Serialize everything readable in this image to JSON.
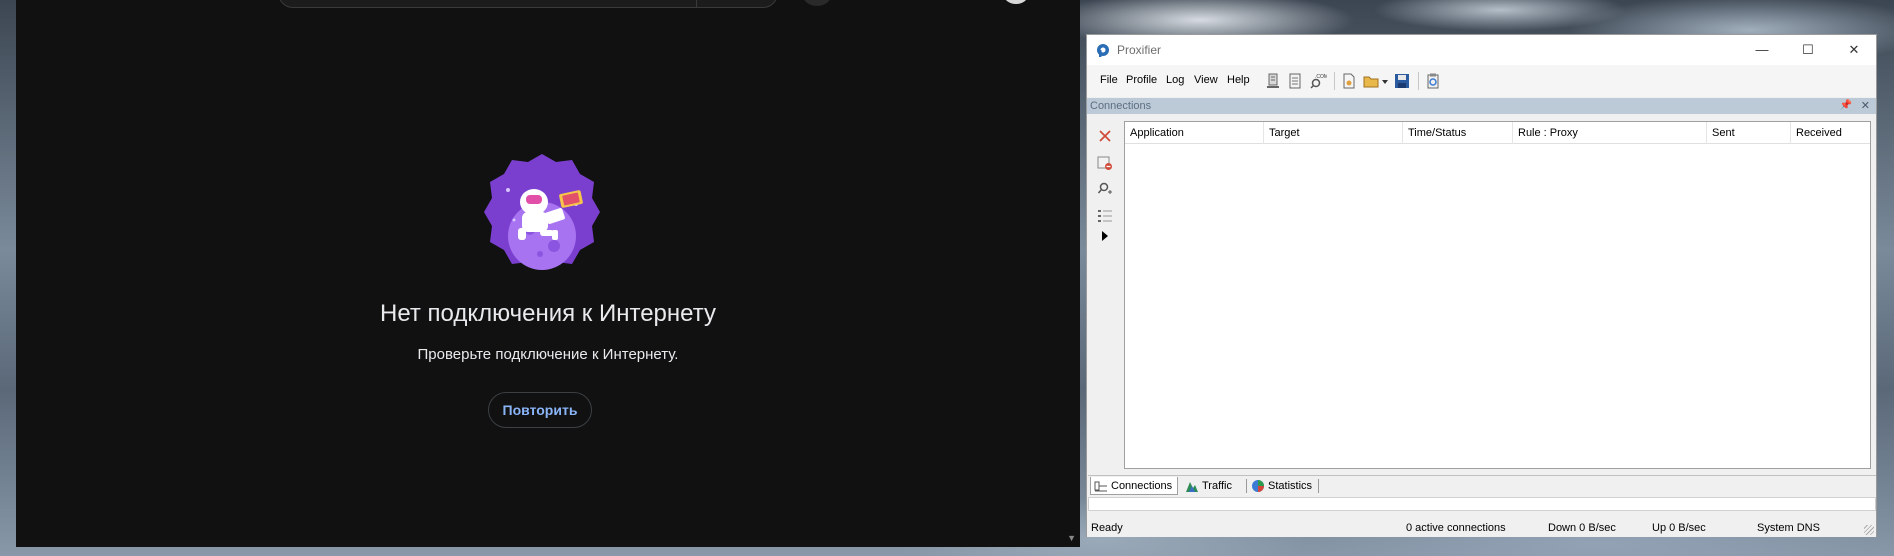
{
  "browser": {
    "offline_title": "Нет подключения к Интернету",
    "offline_subtitle": "Проверьте подключение к Интернету.",
    "retry_label": "Повторить",
    "scroll_arrow": "▼"
  },
  "proxifier": {
    "title": "Proxifier",
    "window_controls": {
      "minimize": "—",
      "maximize": "☐",
      "close": "✕"
    },
    "menu": [
      "File",
      "Profile",
      "Log",
      "View",
      "Help"
    ],
    "toolbar_icons": [
      "proxy-servers-icon",
      "proxification-rules-icon",
      "name-resolution-icon",
      "new-profile-icon",
      "open-profile-icon",
      "save-profile-icon",
      "clipboard-icon"
    ],
    "panel_title": "Connections",
    "side_icons": [
      "close-connection-icon",
      "block-icon",
      "find-icon",
      "details-icon",
      "expand-arrow-icon"
    ],
    "columns": [
      "Application",
      "Target",
      "Time/Status",
      "Rule : Proxy",
      "Sent",
      "Received"
    ],
    "tabs": [
      {
        "label": "Connections",
        "icon": "connections-icon",
        "active": true
      },
      {
        "label": "Traffic",
        "icon": "traffic-icon",
        "active": false
      },
      {
        "label": "Statistics",
        "icon": "statistics-icon",
        "active": false
      }
    ],
    "status": {
      "ready": "Ready",
      "connections": "0 active connections",
      "down": "Down 0 B/sec",
      "up": "Up 0 B/sec",
      "dns": "System DNS"
    },
    "colors": {
      "panel_header": "#bcc9d6",
      "accent_link": "#8ab4f8"
    }
  }
}
